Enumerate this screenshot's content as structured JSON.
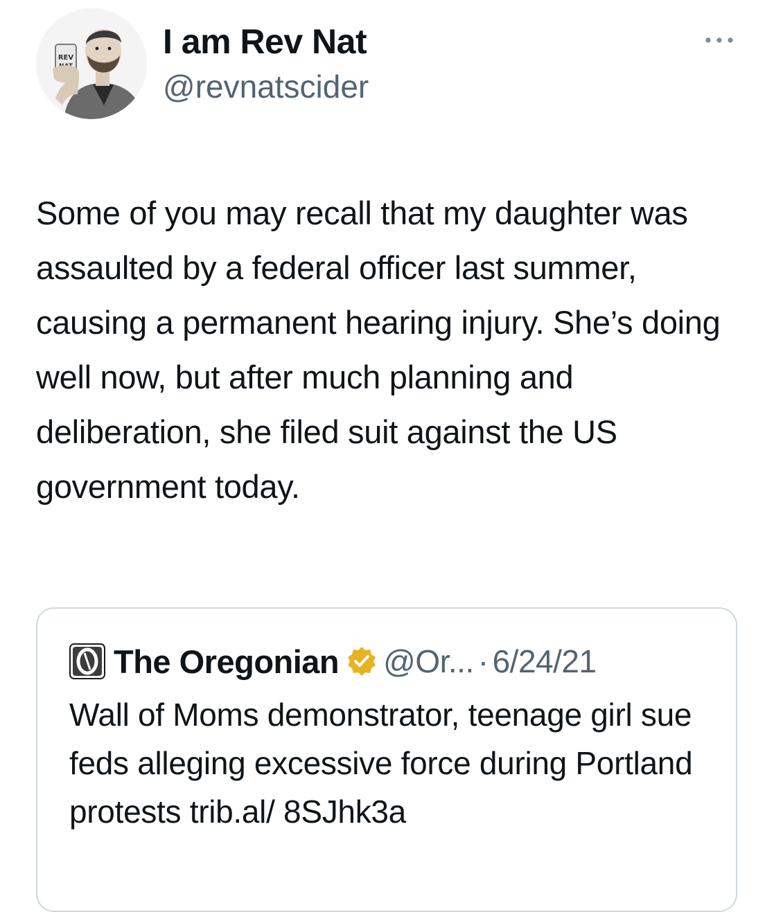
{
  "author": {
    "display_name": "I am Rev Nat",
    "handle": "@revnatscider",
    "avatar_icon": "illustrated-man-with-cider-can",
    "avatar_can_label": "REV NAT"
  },
  "more_icon": "more-horizontal-icon",
  "tweet": {
    "text": "Some of you may recall that my daughter was assaulted by a federal officer last summer, causing a permanent hearing injury. She’s doing well now, but after much planning and deliberation, she filed suit against the US government today."
  },
  "quoted_tweet": {
    "display_name": "The Oregonian",
    "handle": "@Or...",
    "separator": "·",
    "date": "6/24/21",
    "logo_icon": "oregonian-logo-icon",
    "badge_icon": "gold-verified-badge-icon",
    "text": "Wall of Moms demonstrator, teenage girl sue feds alleging excessive force during Portland protests trib.al/ 8SJhk3a"
  },
  "colors": {
    "text_primary": "#0f1419",
    "text_secondary": "#536471",
    "card_border": "#cfd9de",
    "verified_gold": "#e8b221"
  }
}
